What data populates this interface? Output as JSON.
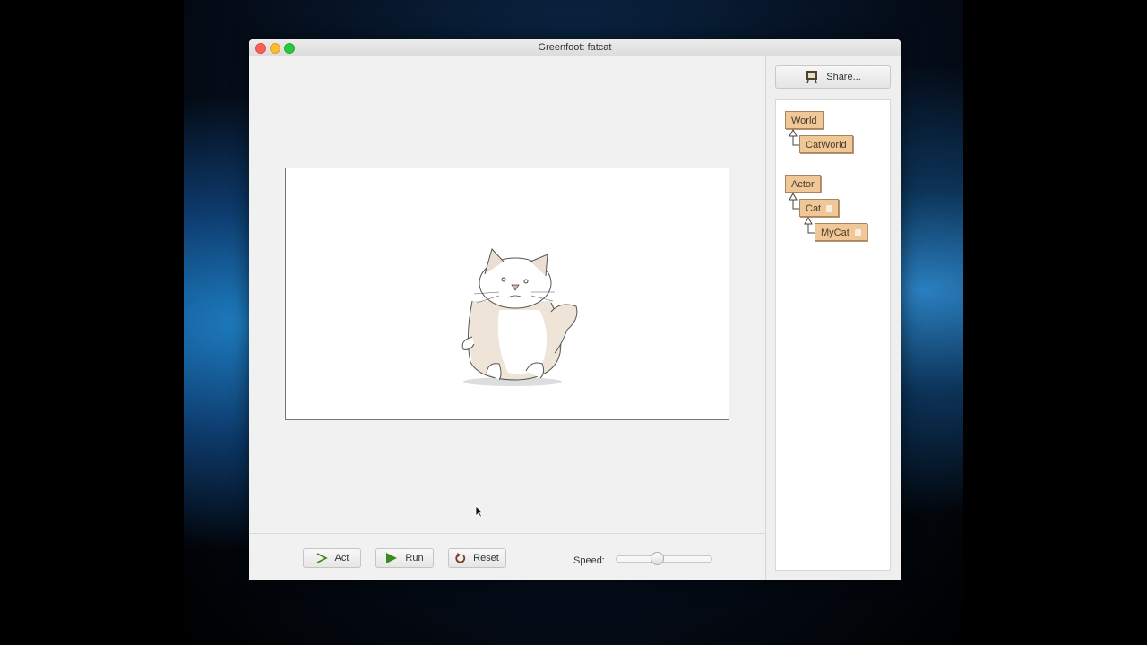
{
  "window": {
    "title": "Greenfoot: fatcat"
  },
  "toolbar": {
    "act_label": "Act",
    "run_label": "Run",
    "reset_label": "Reset",
    "speed_label": "Speed:",
    "speed_value": 0.41
  },
  "sidebar": {
    "share_label": "Share...",
    "classes": [
      {
        "name": "World",
        "pic": false
      },
      {
        "name": "CatWorld",
        "pic": false
      },
      {
        "name": "Actor",
        "pic": false
      },
      {
        "name": "Cat",
        "pic": true
      },
      {
        "name": "MyCat",
        "pic": true
      }
    ]
  },
  "colors": {
    "class_box": "#f0c898",
    "run_green": "#3a8a1e"
  }
}
